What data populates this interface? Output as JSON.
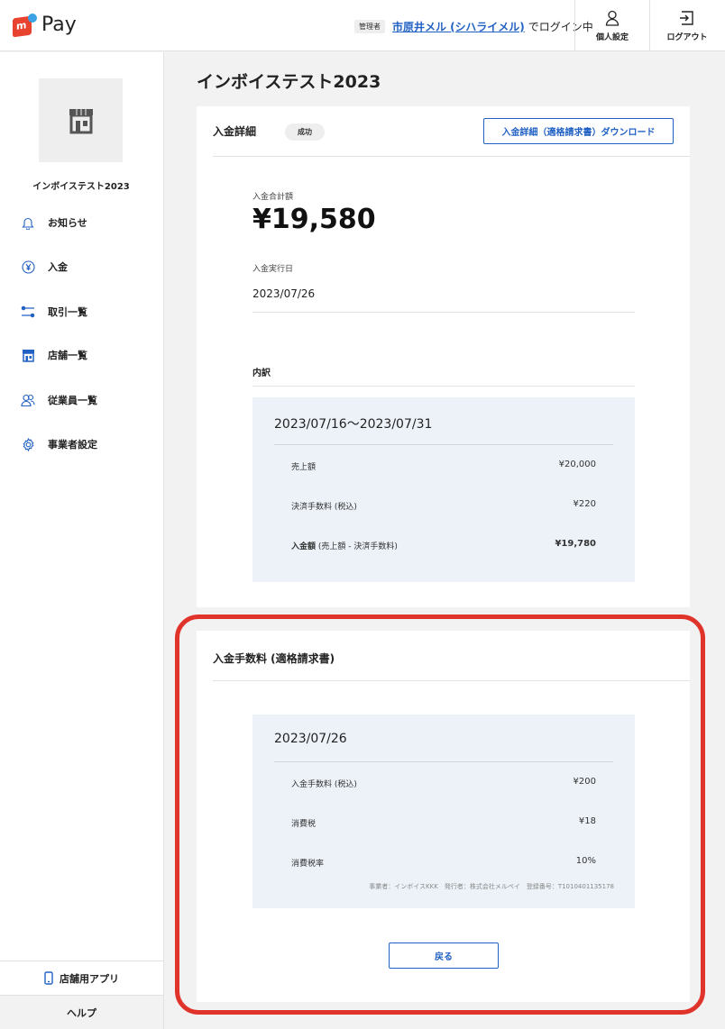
{
  "header": {
    "logo_text": "Pay",
    "logo_mark_letter": "m",
    "admin_badge": "管理者",
    "user_name": "市原井メル (シハライメル)",
    "login_suffix": "でログイン中",
    "personal_settings": "個人設定",
    "logout": "ログアウト"
  },
  "sidebar": {
    "store_name": "インボイステスト2023",
    "items": [
      {
        "label": "お知らせ",
        "icon": "bell-icon"
      },
      {
        "label": "入金",
        "icon": "yen-circle-icon"
      },
      {
        "label": "取引一覧",
        "icon": "transfer-icon"
      },
      {
        "label": "店舗一覧",
        "icon": "store-icon"
      },
      {
        "label": "従業員一覧",
        "icon": "people-icon"
      },
      {
        "label": "事業者設定",
        "icon": "gear-icon"
      }
    ],
    "store_app": "店舗用アプリ",
    "help": "ヘルプ"
  },
  "main": {
    "page_title": "インボイステスト2023",
    "detail": {
      "title": "入金詳細",
      "status": "成功",
      "download_button": "入金詳細（適格請求書）ダウンロード",
      "total_label": "入金合計額",
      "total_amount": "¥19,580",
      "date_label": "入金実行日",
      "date_value": "2023/07/26",
      "breakdown_title": "内訳",
      "period": "2023/07/16〜2023/07/31",
      "rows": [
        {
          "label": "売上額",
          "value": "¥20,000"
        },
        {
          "label": "決済手数料 (税込)",
          "value": "¥220"
        },
        {
          "label_bold": "入金額",
          "label_rest": " (売上額 - 決済手数料)",
          "value": "¥19,780"
        }
      ]
    },
    "fee": {
      "title": "入金手数料 (適格請求書)",
      "date": "2023/07/26",
      "rows": [
        {
          "label": "入金手数料 (税込)",
          "value": "¥200"
        },
        {
          "label": "消費税",
          "value": "¥18"
        },
        {
          "label": "消費税率",
          "value": "10%"
        }
      ],
      "footnote": "事業者：インボイスKKK　発行者：株式会社メルペイ　登録番号：T1010401135178",
      "back_button": "戻る"
    }
  },
  "colors": {
    "accent": "#2261c4",
    "logo_red": "#e8432f",
    "logo_blue": "#3aa3e6",
    "highlight": "#e0332a",
    "panel_bg": "#edf2f9"
  }
}
